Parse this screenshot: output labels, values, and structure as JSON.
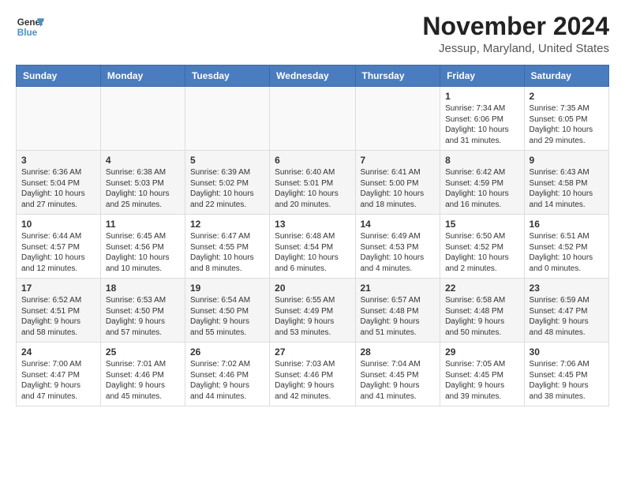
{
  "logo": {
    "line1": "General",
    "line2": "Blue"
  },
  "title": "November 2024",
  "subtitle": "Jessup, Maryland, United States",
  "weekdays": [
    "Sunday",
    "Monday",
    "Tuesday",
    "Wednesday",
    "Thursday",
    "Friday",
    "Saturday"
  ],
  "weeks": [
    [
      {
        "day": "",
        "info": ""
      },
      {
        "day": "",
        "info": ""
      },
      {
        "day": "",
        "info": ""
      },
      {
        "day": "",
        "info": ""
      },
      {
        "day": "",
        "info": ""
      },
      {
        "day": "1",
        "info": "Sunrise: 7:34 AM\nSunset: 6:06 PM\nDaylight: 10 hours\nand 31 minutes."
      },
      {
        "day": "2",
        "info": "Sunrise: 7:35 AM\nSunset: 6:05 PM\nDaylight: 10 hours\nand 29 minutes."
      }
    ],
    [
      {
        "day": "3",
        "info": "Sunrise: 6:36 AM\nSunset: 5:04 PM\nDaylight: 10 hours\nand 27 minutes."
      },
      {
        "day": "4",
        "info": "Sunrise: 6:38 AM\nSunset: 5:03 PM\nDaylight: 10 hours\nand 25 minutes."
      },
      {
        "day": "5",
        "info": "Sunrise: 6:39 AM\nSunset: 5:02 PM\nDaylight: 10 hours\nand 22 minutes."
      },
      {
        "day": "6",
        "info": "Sunrise: 6:40 AM\nSunset: 5:01 PM\nDaylight: 10 hours\nand 20 minutes."
      },
      {
        "day": "7",
        "info": "Sunrise: 6:41 AM\nSunset: 5:00 PM\nDaylight: 10 hours\nand 18 minutes."
      },
      {
        "day": "8",
        "info": "Sunrise: 6:42 AM\nSunset: 4:59 PM\nDaylight: 10 hours\nand 16 minutes."
      },
      {
        "day": "9",
        "info": "Sunrise: 6:43 AM\nSunset: 4:58 PM\nDaylight: 10 hours\nand 14 minutes."
      }
    ],
    [
      {
        "day": "10",
        "info": "Sunrise: 6:44 AM\nSunset: 4:57 PM\nDaylight: 10 hours\nand 12 minutes."
      },
      {
        "day": "11",
        "info": "Sunrise: 6:45 AM\nSunset: 4:56 PM\nDaylight: 10 hours\nand 10 minutes."
      },
      {
        "day": "12",
        "info": "Sunrise: 6:47 AM\nSunset: 4:55 PM\nDaylight: 10 hours\nand 8 minutes."
      },
      {
        "day": "13",
        "info": "Sunrise: 6:48 AM\nSunset: 4:54 PM\nDaylight: 10 hours\nand 6 minutes."
      },
      {
        "day": "14",
        "info": "Sunrise: 6:49 AM\nSunset: 4:53 PM\nDaylight: 10 hours\nand 4 minutes."
      },
      {
        "day": "15",
        "info": "Sunrise: 6:50 AM\nSunset: 4:52 PM\nDaylight: 10 hours\nand 2 minutes."
      },
      {
        "day": "16",
        "info": "Sunrise: 6:51 AM\nSunset: 4:52 PM\nDaylight: 10 hours\nand 0 minutes."
      }
    ],
    [
      {
        "day": "17",
        "info": "Sunrise: 6:52 AM\nSunset: 4:51 PM\nDaylight: 9 hours\nand 58 minutes."
      },
      {
        "day": "18",
        "info": "Sunrise: 6:53 AM\nSunset: 4:50 PM\nDaylight: 9 hours\nand 57 minutes."
      },
      {
        "day": "19",
        "info": "Sunrise: 6:54 AM\nSunset: 4:50 PM\nDaylight: 9 hours\nand 55 minutes."
      },
      {
        "day": "20",
        "info": "Sunrise: 6:55 AM\nSunset: 4:49 PM\nDaylight: 9 hours\nand 53 minutes."
      },
      {
        "day": "21",
        "info": "Sunrise: 6:57 AM\nSunset: 4:48 PM\nDaylight: 9 hours\nand 51 minutes."
      },
      {
        "day": "22",
        "info": "Sunrise: 6:58 AM\nSunset: 4:48 PM\nDaylight: 9 hours\nand 50 minutes."
      },
      {
        "day": "23",
        "info": "Sunrise: 6:59 AM\nSunset: 4:47 PM\nDaylight: 9 hours\nand 48 minutes."
      }
    ],
    [
      {
        "day": "24",
        "info": "Sunrise: 7:00 AM\nSunset: 4:47 PM\nDaylight: 9 hours\nand 47 minutes."
      },
      {
        "day": "25",
        "info": "Sunrise: 7:01 AM\nSunset: 4:46 PM\nDaylight: 9 hours\nand 45 minutes."
      },
      {
        "day": "26",
        "info": "Sunrise: 7:02 AM\nSunset: 4:46 PM\nDaylight: 9 hours\nand 44 minutes."
      },
      {
        "day": "27",
        "info": "Sunrise: 7:03 AM\nSunset: 4:46 PM\nDaylight: 9 hours\nand 42 minutes."
      },
      {
        "day": "28",
        "info": "Sunrise: 7:04 AM\nSunset: 4:45 PM\nDaylight: 9 hours\nand 41 minutes."
      },
      {
        "day": "29",
        "info": "Sunrise: 7:05 AM\nSunset: 4:45 PM\nDaylight: 9 hours\nand 39 minutes."
      },
      {
        "day": "30",
        "info": "Sunrise: 7:06 AM\nSunset: 4:45 PM\nDaylight: 9 hours\nand 38 minutes."
      }
    ]
  ]
}
